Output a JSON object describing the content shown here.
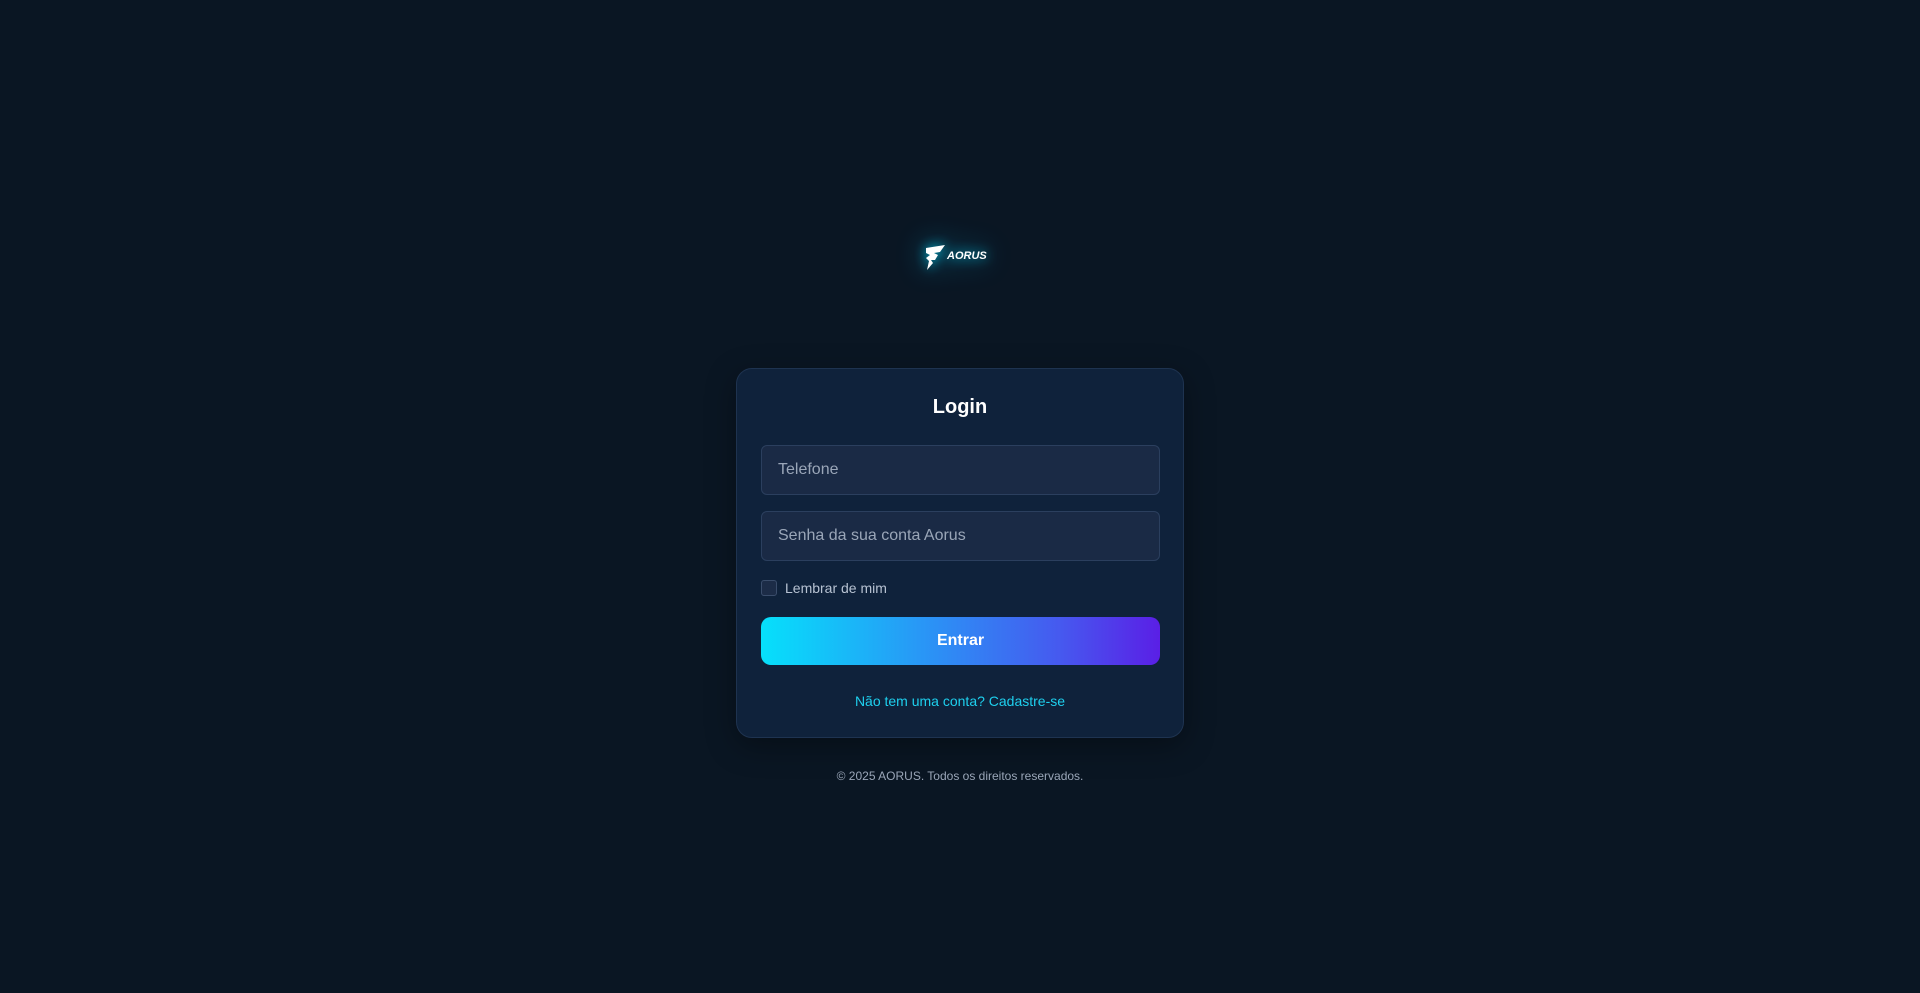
{
  "brand": {
    "logo_text": "AORUS",
    "logo_icon": "aorus-eagle-logo",
    "glow_color": "#00dcff"
  },
  "login": {
    "title": "Login",
    "phone_placeholder": "Telefone",
    "password_placeholder": "Senha da sua conta Aorus",
    "remember_label": "Lembrar de mim",
    "remember_checked": false,
    "submit_label": "Entrar",
    "signup_link": "Não tem uma conta? Cadastre-se"
  },
  "footer": {
    "copyright": "© 2025 AORUS. Todos os direitos reservados."
  },
  "colors": {
    "background": "#0a1623",
    "card": "#0f223b",
    "input": "#1a2a45",
    "accent": "#1ed0ee",
    "gradient_start": "#06e0fb",
    "gradient_end": "#5a1fe6"
  }
}
